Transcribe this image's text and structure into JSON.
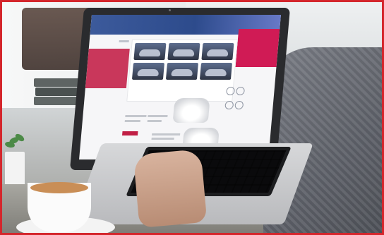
{
  "screen": {
    "site_title": "",
    "section_heading": ""
  },
  "colors": {
    "frame_border": "#d4262c",
    "site_header": "#2d4b8c",
    "accent_pink": "#d01b55"
  }
}
